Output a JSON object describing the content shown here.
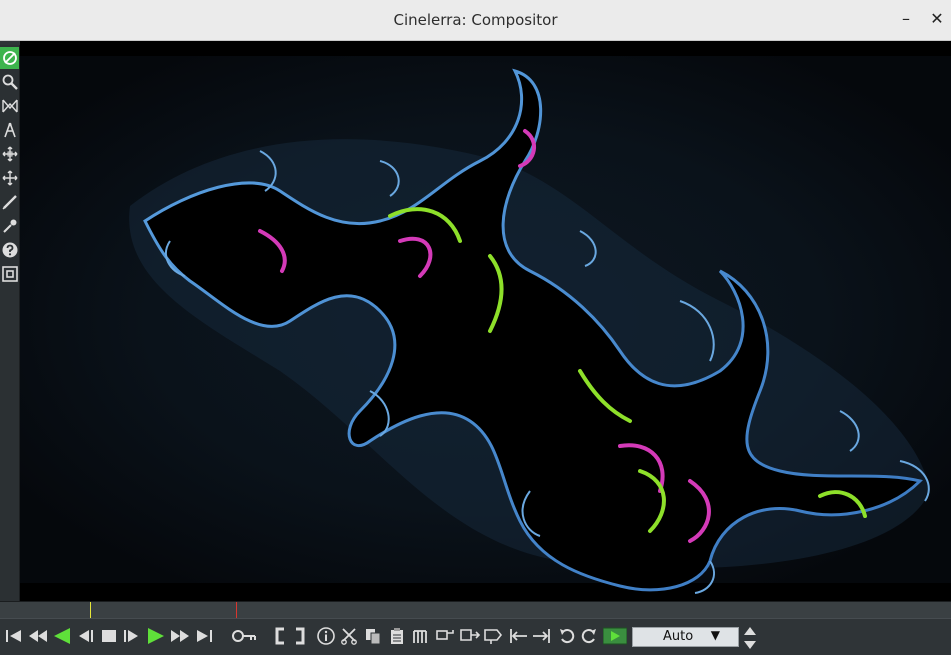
{
  "window": {
    "title": "Cinelerra: Compositor",
    "minimize_label": "–",
    "close_label": "✕"
  },
  "tools": [
    {
      "name": "protect-icon",
      "active": true
    },
    {
      "name": "zoom-icon"
    },
    {
      "name": "mask-icon"
    },
    {
      "name": "ruler-icon"
    },
    {
      "name": "camera-move-icon"
    },
    {
      "name": "projector-move-icon"
    },
    {
      "name": "crop-icon"
    },
    {
      "name": "eyedrop-icon"
    },
    {
      "name": "help-icon"
    },
    {
      "name": "safe-regions-icon"
    }
  ],
  "transport": [
    "rewind-to-start-icon",
    "fast-reverse-icon",
    "play-reverse-icon",
    "frame-back-icon",
    "stop-icon",
    "frame-forward-icon",
    "play-icon",
    "fast-forward-icon",
    "jump-to-end-icon",
    "keyframe-icon",
    "in-point-icon",
    "out-point-icon",
    "info-icon",
    "cut-icon",
    "copy-icon",
    "paste-icon",
    "splice-icon",
    "overwrite-icon",
    "to-clip-icon",
    "label-icon",
    "prev-label-icon",
    "next-label-icon",
    "undo-icon",
    "redo-icon",
    "play-mode-icon"
  ],
  "zoom": {
    "value": "Auto",
    "dropdown_glyph": "▼"
  },
  "colors": {
    "accent_green": "#3db44d",
    "in_marker": "#e6e63a",
    "out_marker": "#d8362f",
    "fractal_bg_glow": "#2a4a6a"
  }
}
